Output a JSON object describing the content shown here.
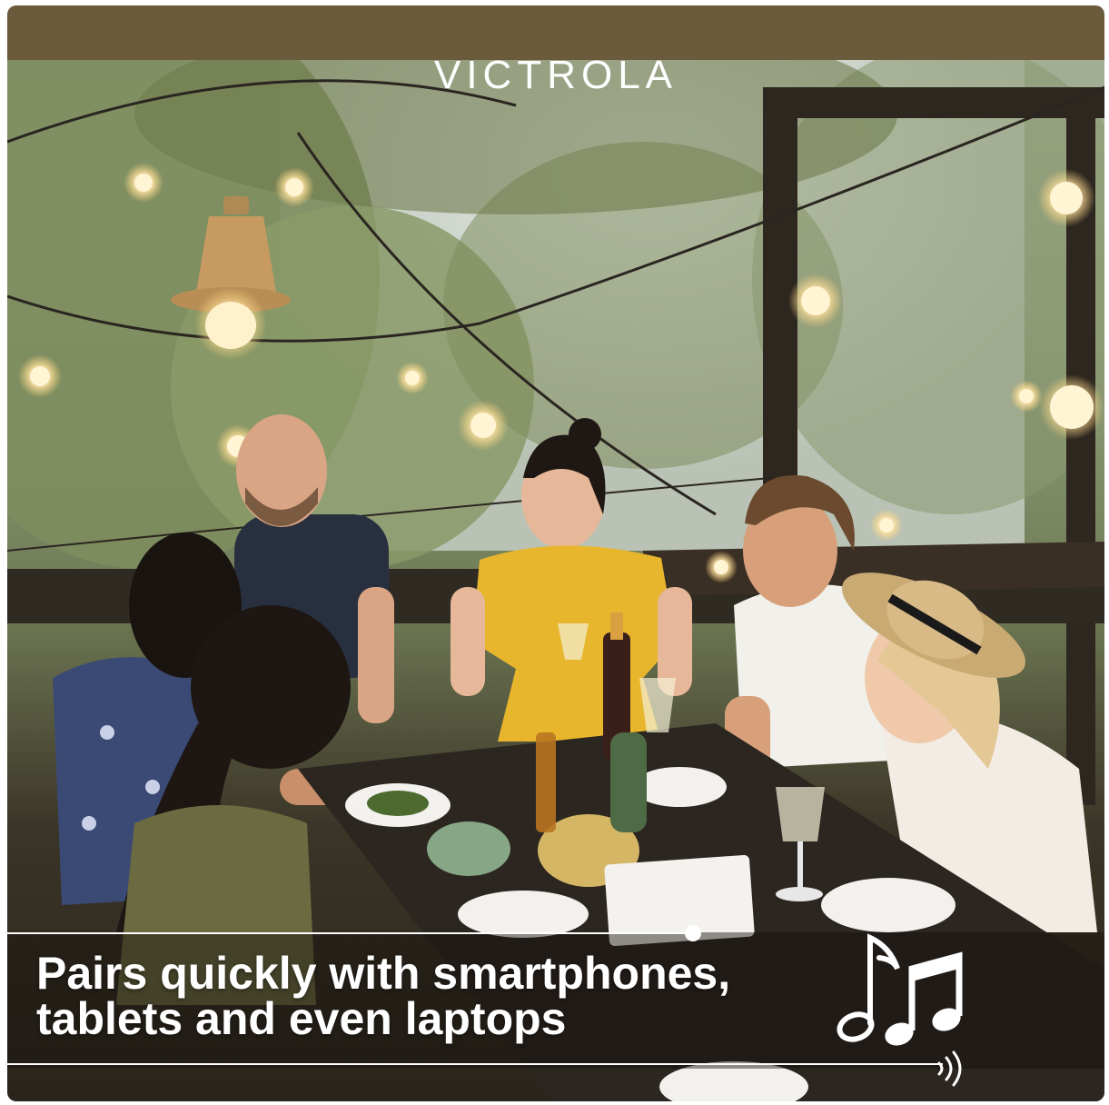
{
  "brand": {
    "name": "VICTROLA"
  },
  "caption": {
    "line1": "Pairs quickly with smartphones,",
    "line2": "tablets and even laptops"
  },
  "icons": [
    "music-notes-icon",
    "sound-waves-icon"
  ],
  "colors": {
    "text": "#ffffff",
    "dress_yellow": "#e8b62c",
    "foliage": "#8f9f7c"
  }
}
